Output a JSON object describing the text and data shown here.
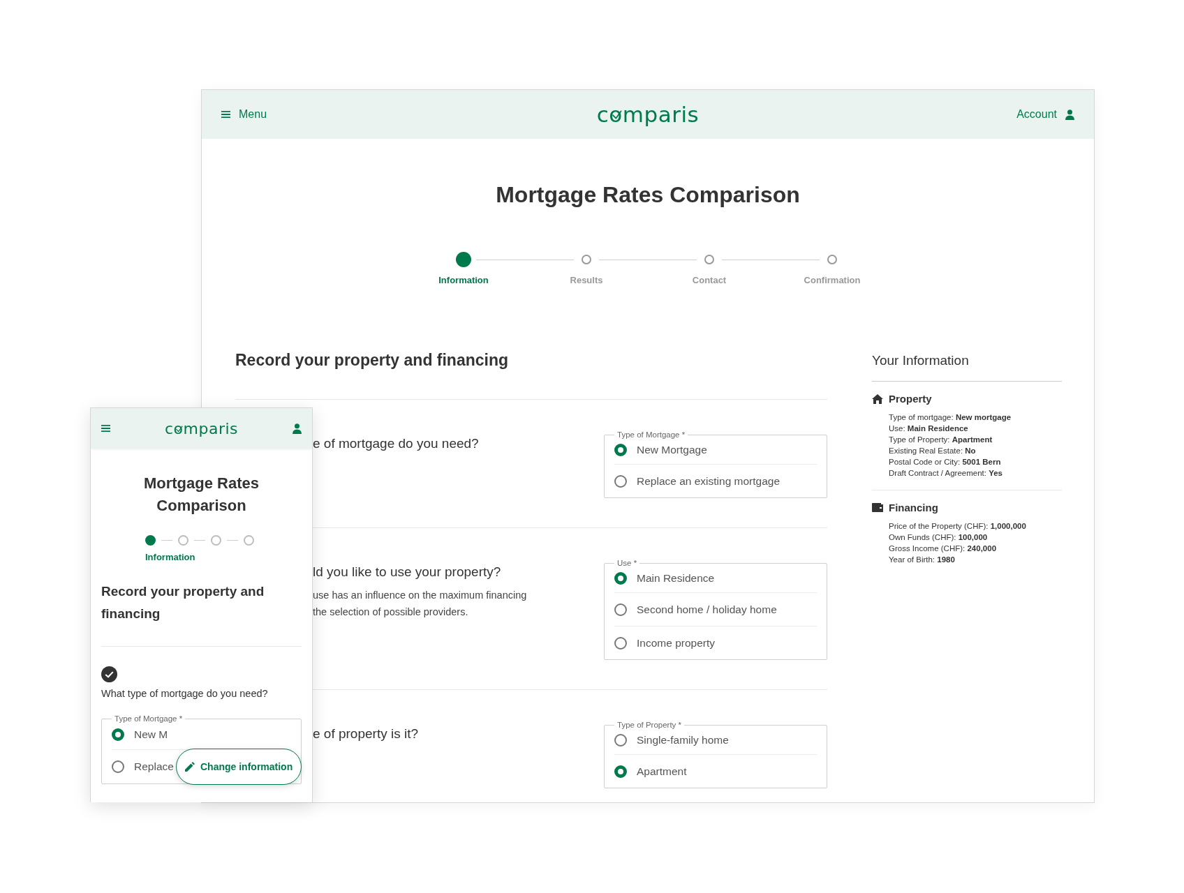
{
  "desktop": {
    "header": {
      "menu": "Menu",
      "logo": "comparis",
      "account": "Account"
    },
    "title": "Mortgage Rates Comparison",
    "steps": [
      {
        "label": "Information",
        "selected": true
      },
      {
        "label": "Results",
        "selected": false
      },
      {
        "label": "Contact",
        "selected": false
      },
      {
        "label": "Confirmation",
        "selected": false
      }
    ],
    "heading": "Record your property and financing",
    "sections": [
      {
        "question": "e of mortgage do you need?",
        "legend": "Type of Mortgage *",
        "options": [
          {
            "label": "New Mortgage",
            "selected": true
          },
          {
            "label": "Replace an existing mortgage",
            "selected": false
          }
        ]
      },
      {
        "question": "ld you like to use your property?",
        "description_lines": [
          "use has an influence on the maximum financing",
          "the selection of possible providers."
        ],
        "legend": "Use *",
        "options": [
          {
            "label": "Main Residence",
            "selected": true
          },
          {
            "label": "Second home / holiday home",
            "selected": false
          },
          {
            "label": "Income property",
            "selected": false
          }
        ]
      },
      {
        "question": "e of property is it?",
        "legend": "Type of Property *",
        "options": [
          {
            "label": "Single-family home",
            "selected": false
          },
          {
            "label": "Apartment",
            "selected": true
          }
        ]
      }
    ],
    "sidebar": {
      "title": "Your Information",
      "groups": [
        {
          "kind": "property",
          "title": "Property",
          "lines": [
            "Type of mortgage: **New mortgage**",
            "Use: **Main Residence**",
            "Type of Property: **Apartment**",
            "Existing Real Estate: **No**",
            "Postal Code or City: **5001 Bern**",
            "Draft Contract / Agreement: **Yes**"
          ]
        },
        {
          "kind": "financing",
          "title": "Financing",
          "lines": [
            "Price of the Property (CHF): **1,000,000**",
            "Own Funds (CHF): **100,000**",
            "Gross Income (CHF): **240,000**",
            "Year of Birth: **1980**"
          ]
        }
      ]
    }
  },
  "mobile": {
    "logo": "comparis",
    "title": "Mortgage Rates Comparison",
    "steps": [
      {
        "selected": true
      },
      {
        "selected": false
      },
      {
        "selected": false
      },
      {
        "selected": false
      }
    ],
    "step_label": "Information",
    "heading": "Record your property and financing",
    "question": {
      "done": true,
      "text": "What type of mortgage do you need?",
      "legend": "Type of Mortgage *",
      "options": [
        {
          "label": "New M",
          "selected": true
        },
        {
          "label": "Replace",
          "selected": false
        }
      ]
    },
    "change_button": "Change information"
  }
}
